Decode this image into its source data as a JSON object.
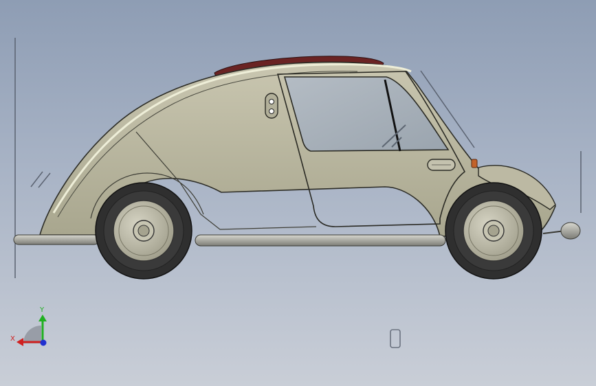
{
  "viewport": {
    "background_top": "#8e9db4",
    "background_bottom": "#c9ced7"
  },
  "model": {
    "body_color": "#b9b6a0",
    "tire_color": "#2f2f2f",
    "roof_strip_color": "#6a2323",
    "indicator_color": "#c2622a"
  },
  "triad": {
    "x_label": "X",
    "y_label": "Y",
    "x_color": "#d02020",
    "y_color": "#20b020",
    "z_color": "#2030d0"
  },
  "icons": [
    "view-triad-icon",
    "model-view-icon"
  ]
}
